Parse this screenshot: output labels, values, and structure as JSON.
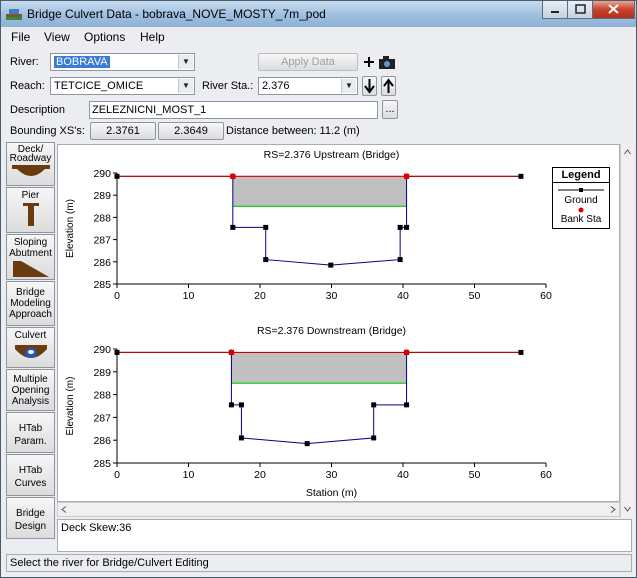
{
  "window": {
    "title": "Bridge Culvert Data - bobrava_NOVE_MOSTY_7m_pod"
  },
  "menu": [
    "File",
    "View",
    "Options",
    "Help"
  ],
  "river": {
    "label": "River:",
    "value": "BOBRAVA"
  },
  "apply_data": "Apply Data",
  "reach": {
    "label": "Reach:",
    "value": "TETCICE_OMICE"
  },
  "river_sta": {
    "label": "River Sta.:",
    "value": "2.376"
  },
  "description": {
    "label": "Description",
    "value": "ZELEZNICNI_MOST_1"
  },
  "bounding": {
    "label": "Bounding XS's:",
    "upstream": "2.3761",
    "downstream": "2.3649",
    "distance": "Distance between: 11.2 (m)"
  },
  "sidebar": [
    {
      "id": "deck",
      "label": "Deck/\nRoadway"
    },
    {
      "id": "pier",
      "label": "Pier"
    },
    {
      "id": "abutment",
      "label": "Sloping\nAbutment"
    },
    {
      "id": "modeling",
      "label": "Bridge\nModeling\nApproach"
    },
    {
      "id": "culvert",
      "label": "Culvert"
    },
    {
      "id": "multiple",
      "label": "Multiple\nOpening\nAnalysis"
    },
    {
      "id": "htab-param",
      "label": "HTab\nParam."
    },
    {
      "id": "htab-curves",
      "label": "HTab\nCurves"
    },
    {
      "id": "bridge-design",
      "label": "Bridge\nDesign"
    }
  ],
  "legend": {
    "title": "Legend",
    "ground": "Ground",
    "bank": "Bank Sta"
  },
  "colors": {
    "ground": "#00008b",
    "deck": "#cc0000",
    "low_chord": "#00cc00",
    "deck_fill": "#c0c0c0",
    "bank": "#dd0000"
  },
  "chart_data": [
    {
      "type": "line",
      "title": "RS=2.376  Upstream  (Bridge)",
      "xlabel": "",
      "ylabel": "Elevation (m)",
      "xlim": [
        0,
        60
      ],
      "ylim": [
        285,
        290
      ],
      "xticks": [
        0,
        10,
        20,
        30,
        40,
        50,
        60
      ],
      "yticks": [
        285,
        286,
        287,
        288,
        289,
        290
      ],
      "ground": [
        [
          0,
          289.85
        ],
        [
          16.2,
          289.85
        ],
        [
          16.2,
          287.55
        ],
        [
          20.8,
          287.55
        ],
        [
          20.8,
          286.1
        ],
        [
          29.9,
          285.85
        ],
        [
          39.6,
          286.1
        ],
        [
          39.6,
          287.55
        ],
        [
          40.5,
          287.55
        ],
        [
          40.5,
          289.85
        ],
        [
          56.5,
          289.85
        ]
      ],
      "bank_stations": [
        [
          16.2,
          289.85
        ],
        [
          40.5,
          289.85
        ]
      ],
      "deck_top": [
        [
          0,
          289.85
        ],
        [
          56.5,
          289.85
        ]
      ],
      "low_chord": [
        [
          16.2,
          288.5
        ],
        [
          40.5,
          288.5
        ]
      ]
    },
    {
      "type": "line",
      "title": "RS=2.376  Downstream  (Bridge)",
      "xlabel": "Station (m)",
      "ylabel": "Elevation (m)",
      "xlim": [
        0,
        60
      ],
      "ylim": [
        285,
        290
      ],
      "xticks": [
        0,
        10,
        20,
        30,
        40,
        50,
        60
      ],
      "yticks": [
        285,
        286,
        287,
        288,
        289,
        290
      ],
      "ground": [
        [
          0,
          289.85
        ],
        [
          16,
          289.85
        ],
        [
          16,
          287.55
        ],
        [
          17.4,
          287.55
        ],
        [
          17.4,
          286.1
        ],
        [
          26.6,
          285.85
        ],
        [
          35.9,
          286.1
        ],
        [
          35.9,
          287.55
        ],
        [
          40.5,
          287.55
        ],
        [
          40.5,
          289.85
        ],
        [
          56.5,
          289.85
        ]
      ],
      "bank_stations": [
        [
          16,
          289.85
        ],
        [
          40.5,
          289.85
        ]
      ],
      "deck_top": [
        [
          0,
          289.85
        ],
        [
          56.5,
          289.85
        ]
      ],
      "low_chord": [
        [
          16,
          288.5
        ],
        [
          40.5,
          288.5
        ]
      ]
    }
  ],
  "deck_skew": "Deck Skew:36",
  "status": "Select the river for Bridge/Culvert Editing"
}
